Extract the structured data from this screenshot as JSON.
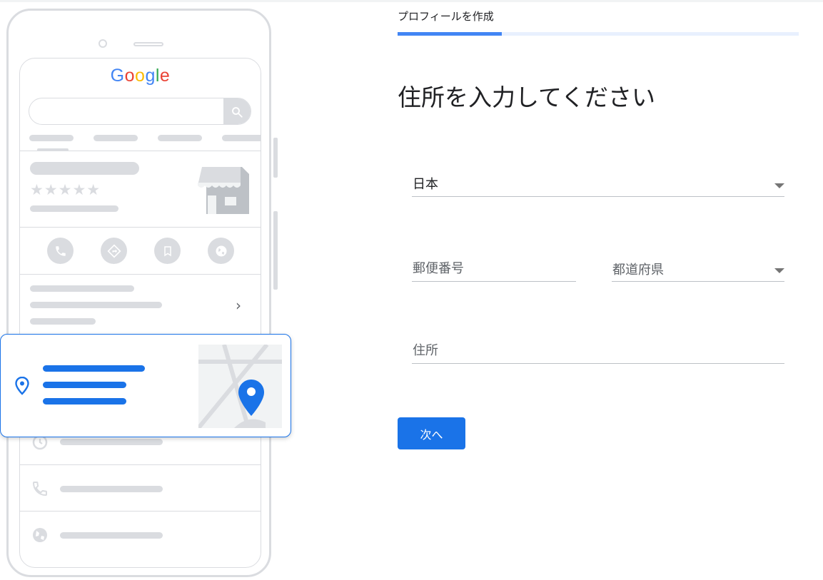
{
  "step": {
    "label": "プロフィールを作成",
    "progress_fraction": 0.26
  },
  "heading": "住所を入力してください",
  "form": {
    "country": {
      "value": "日本"
    },
    "postal_code": {
      "placeholder": "郵便番号"
    },
    "prefecture": {
      "placeholder": "都道府県"
    },
    "address": {
      "placeholder": "住所"
    }
  },
  "next_button_label": "次へ",
  "illustration": {
    "logo_letters": [
      "G",
      "o",
      "o",
      "g",
      "l",
      "e"
    ],
    "logo_colors": [
      "#4285f4",
      "#ea4335",
      "#fbbc05",
      "#4285f4",
      "#34a853",
      "#ea4335"
    ],
    "stars": "★★★★★",
    "chevron": "›",
    "accent_color": "#1a73e8",
    "placeholder_color": "#dadce0",
    "icons": [
      "search-icon",
      "store-icon",
      "phone-icon",
      "directions-icon",
      "bookmark-icon",
      "web-icon",
      "location-pin-icon",
      "map-pin-icon",
      "clock-icon",
      "globe-icon"
    ]
  }
}
